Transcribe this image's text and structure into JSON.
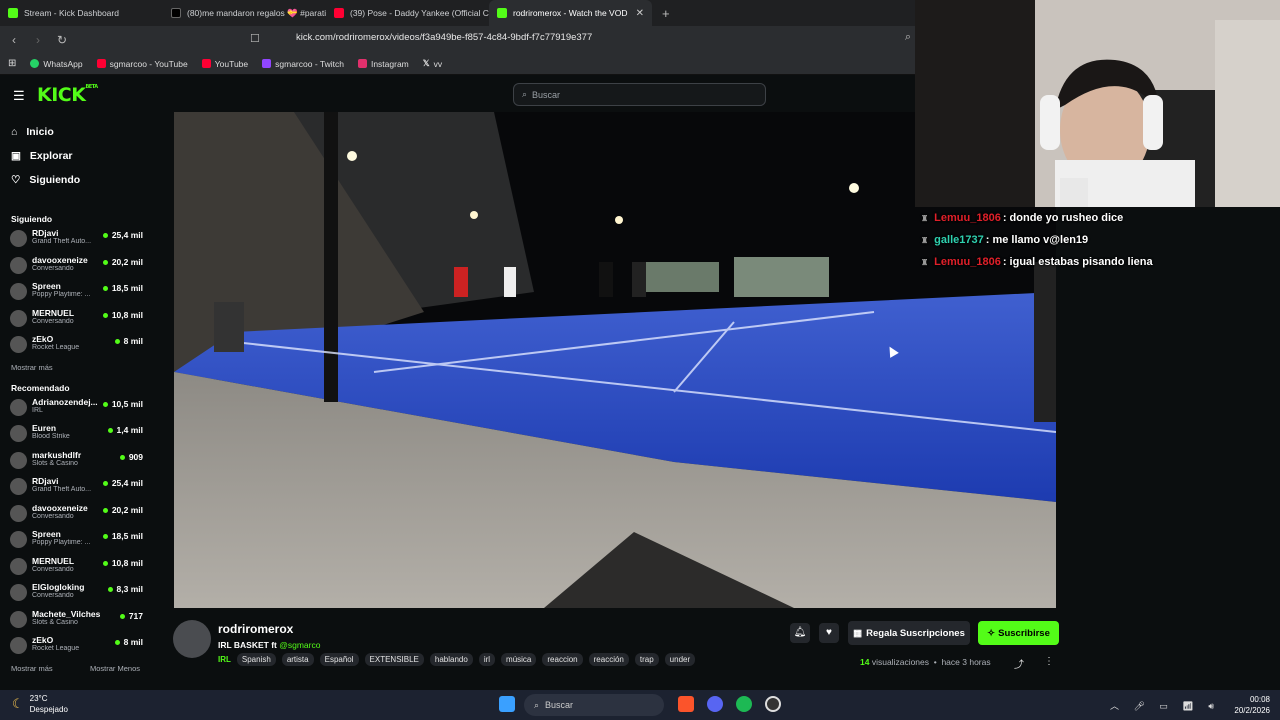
{
  "browser": {
    "tabs": [
      {
        "title": "Stream - Kick Dashboard",
        "color": "#53fc18"
      },
      {
        "title": "(80)me mandaron regalos 💝 #parati",
        "color": "#111111"
      },
      {
        "title": "(39) Pose - Daddy Yankee (Official Ca",
        "color": "#ff0033"
      },
      {
        "title": "rodriromerox - Watch the VOD",
        "color": "#53fc18"
      }
    ],
    "url": "kick.com/rodriromerox/videos/f3a949be-f857-4c84-9bdf-f7c77919e377",
    "bookmarks": [
      {
        "label": "WhatsApp",
        "color": "#25d366"
      },
      {
        "label": "sgmarcoo - YouTube",
        "color": "#ff0033"
      },
      {
        "label": "YouTube",
        "color": "#ff0033"
      },
      {
        "label": "sgmarcoo - Twitch",
        "color": "#9146ff"
      },
      {
        "label": "Instagram",
        "color": "#e1306c"
      },
      {
        "label": "vv",
        "color": "#ffffff"
      }
    ]
  },
  "kick": {
    "logo": "KICK",
    "logo_beta": "BETA",
    "search_placeholder": "Buscar",
    "nav": [
      {
        "label": "Inicio",
        "icon": "home-icon"
      },
      {
        "label": "Explorar",
        "icon": "compass-icon"
      },
      {
        "label": "Siguiendo",
        "icon": "heart-icon"
      }
    ],
    "following_title": "Siguiendo",
    "following": [
      {
        "name": "RDjavi",
        "game": "Grand Theft Auto...",
        "viewers": "25,4 mil"
      },
      {
        "name": "davooxeneize",
        "game": "Conversando",
        "viewers": "20,2 mil"
      },
      {
        "name": "Spreen",
        "game": "Poppy Playtime: ...",
        "viewers": "18,5 mil"
      },
      {
        "name": "MERNUEL",
        "game": "Conversando",
        "viewers": "10,8 mil"
      },
      {
        "name": "zEkO",
        "game": "Rocket League",
        "viewers": "8 mil"
      }
    ],
    "show_more": "Mostrar más",
    "recommended_title": "Recomendado",
    "recommended": [
      {
        "name": "Adrianozendej...",
        "game": "IRL",
        "viewers": "10,5 mil"
      },
      {
        "name": "Euren",
        "game": "Blood Strike",
        "viewers": "1,4 mil"
      },
      {
        "name": "markushdlfr",
        "game": "Slots & Casino",
        "viewers": "909"
      },
      {
        "name": "RDjavi",
        "game": "Grand Theft Auto...",
        "viewers": "25,4 mil"
      },
      {
        "name": "davooxeneize",
        "game": "Conversando",
        "viewers": "20,2 mil"
      },
      {
        "name": "Spreen",
        "game": "Poppy Playtime: ...",
        "viewers": "18,5 mil"
      },
      {
        "name": "MERNUEL",
        "game": "Conversando",
        "viewers": "10,8 mil"
      },
      {
        "name": "ElGlogloking",
        "game": "Conversando",
        "viewers": "8,3 mil"
      },
      {
        "name": "Machete_Vilches",
        "game": "Slots & Casino",
        "viewers": "717"
      },
      {
        "name": "zEkO",
        "game": "Rocket League",
        "viewers": "8 mil"
      }
    ],
    "show_more_2": "Mostrar más",
    "show_less": "Mostrar Menos",
    "video_info": {
      "channel": "rodriromerox",
      "title": "IRL BASKET ft",
      "mention": "@sgmarco",
      "category": "IRL",
      "tags": [
        "Spanish",
        "artista",
        "Español",
        "EXTENSIBLE",
        "hablando",
        "irl",
        "música",
        "reaccion",
        "reacción",
        "trap",
        "under"
      ],
      "gift_subs": "Regala Suscripciones",
      "subscribe": "Suscribirse",
      "views_count": "14",
      "views_label": "visualizaciones",
      "time_ago": "hace 3 horas"
    }
  },
  "chat": [
    {
      "user": "Lemuu_1806",
      "user_color": "#e0202a",
      "text": ": donde yo rusheo dice"
    },
    {
      "user": "galle1737",
      "user_color": "#2fd1b0",
      "text": ": me llamo v@len19"
    },
    {
      "user": "Lemuu_1806",
      "user_color": "#e0202a",
      "text": ": igual estabas pisando liena"
    }
  ],
  "taskbar": {
    "temp": "23°C",
    "weather": "Despejado",
    "search": "Buscar",
    "time": "00:08",
    "date": "20/2/2026"
  }
}
